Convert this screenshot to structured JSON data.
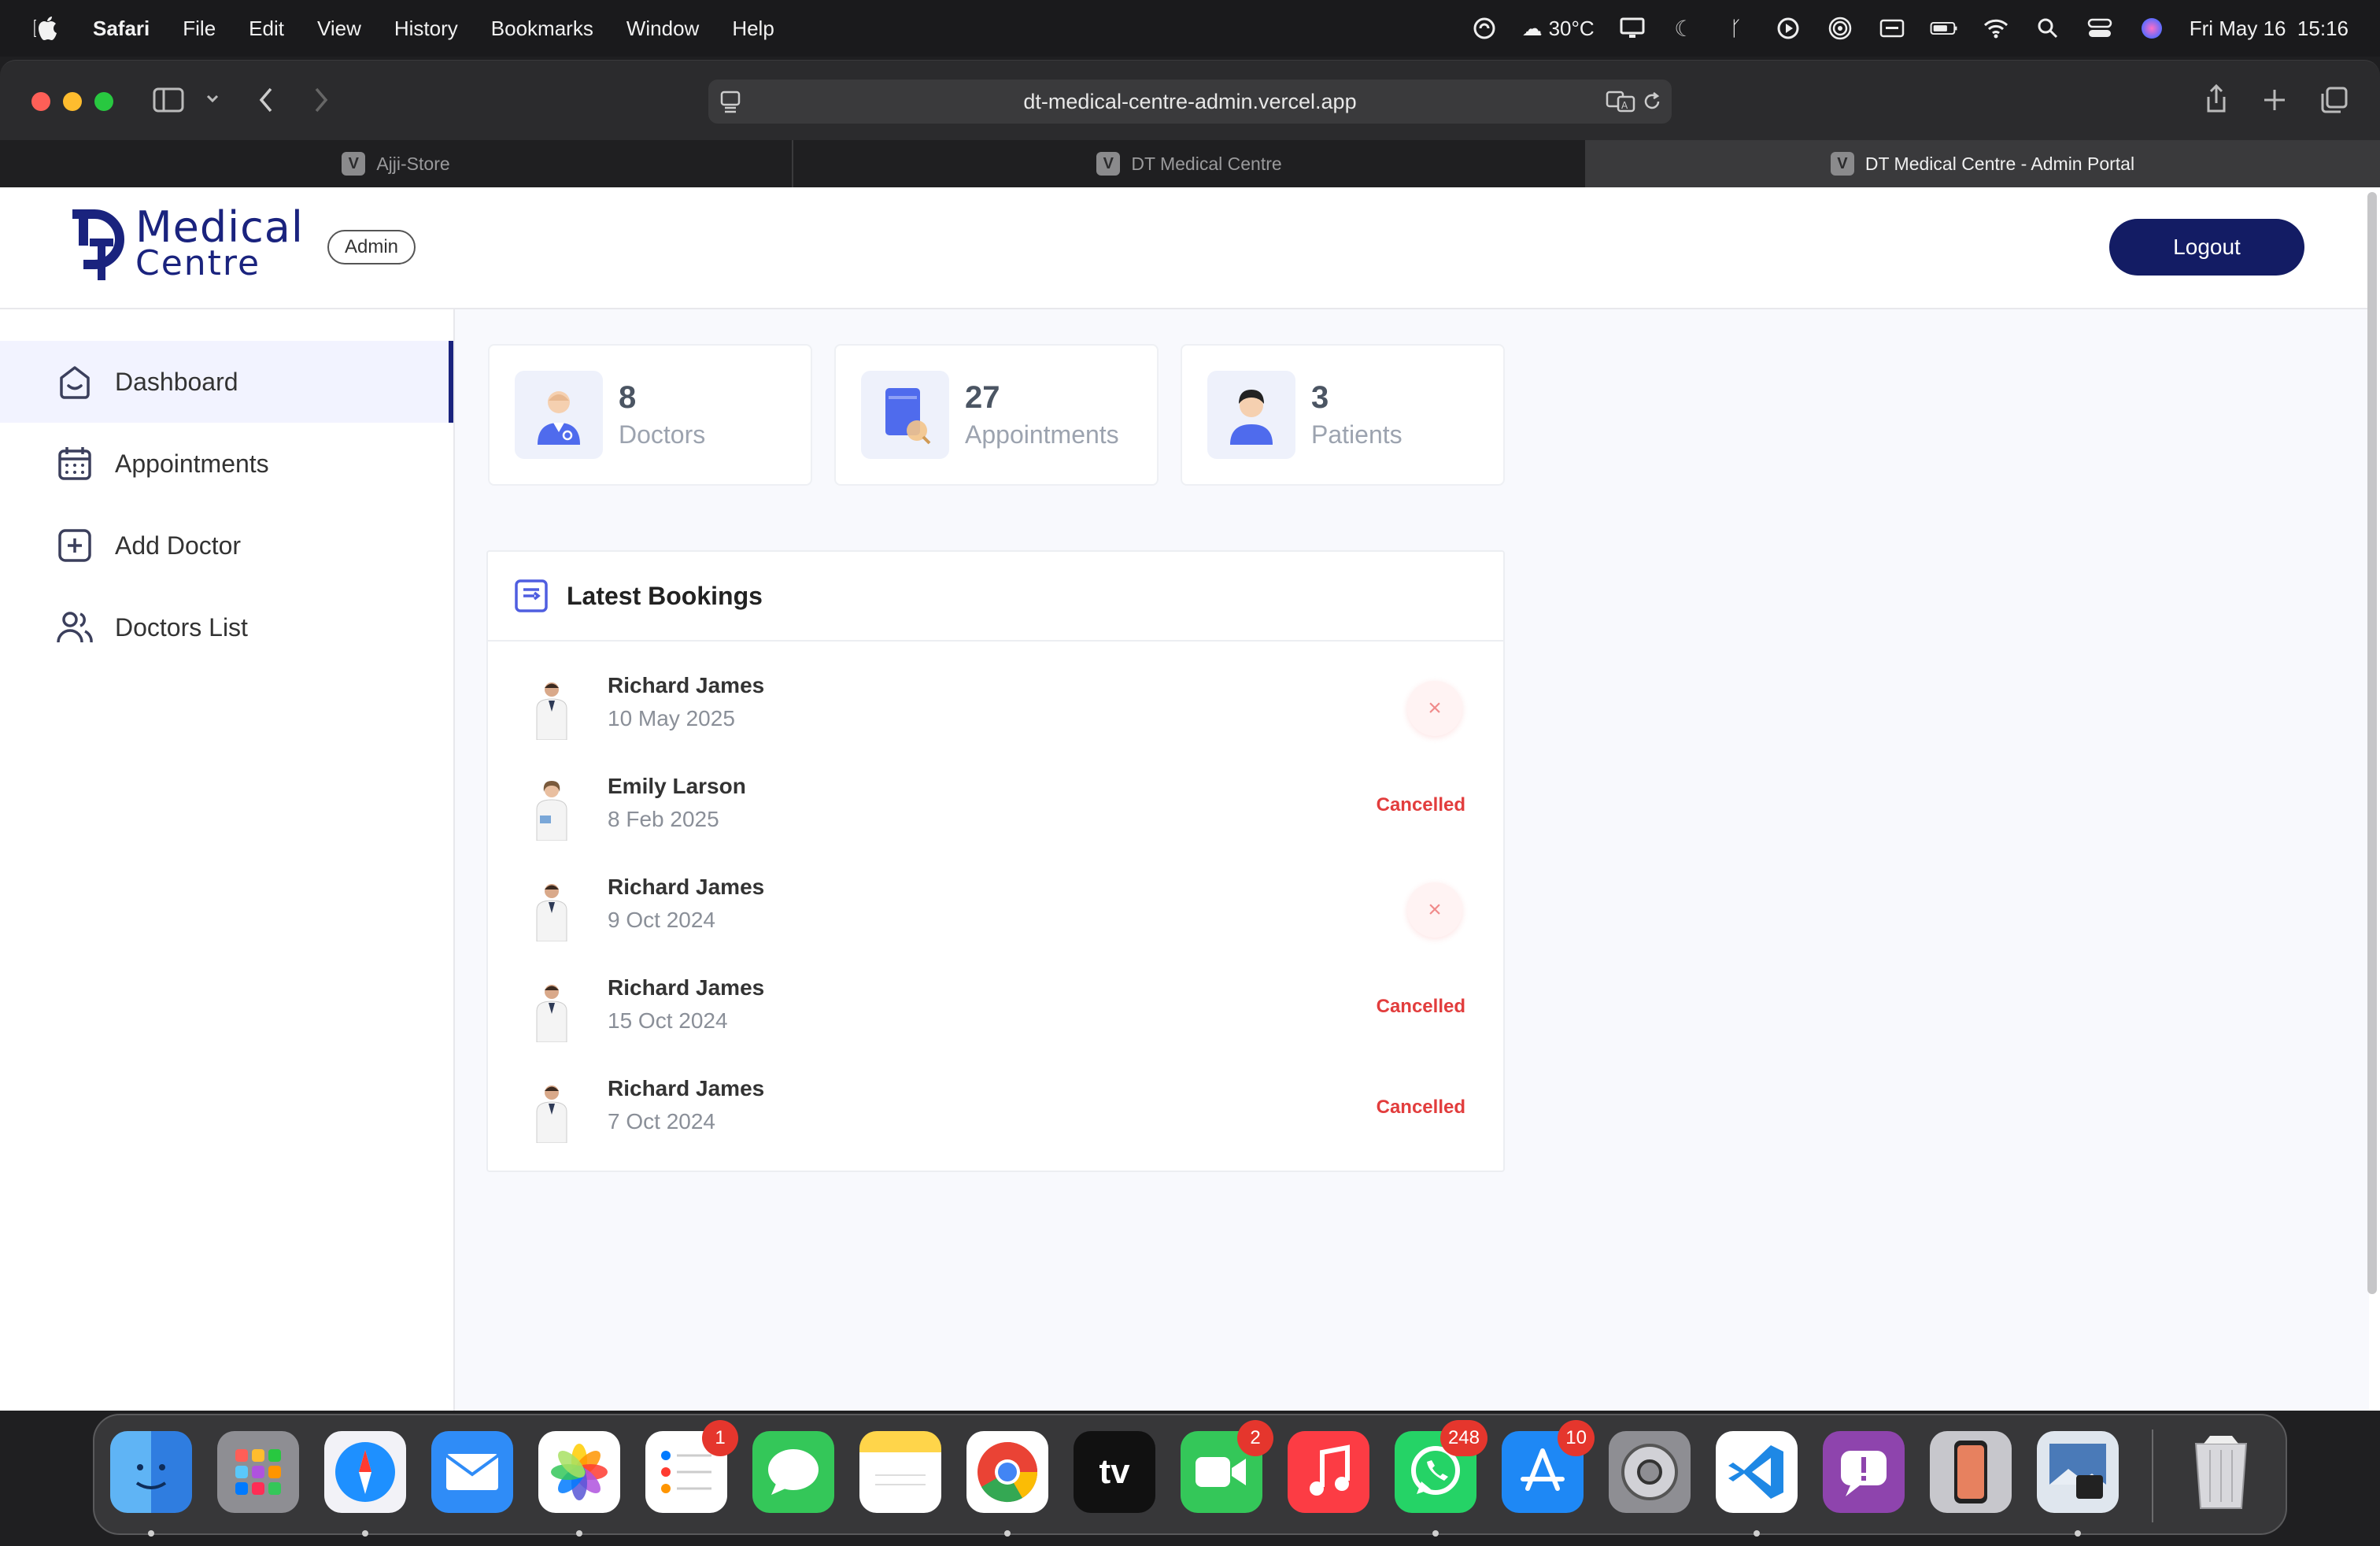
{
  "menubar": {
    "app": "Safari",
    "items": [
      "File",
      "Edit",
      "View",
      "History",
      "Bookmarks",
      "Window",
      "Help"
    ],
    "weather": "30°C",
    "datetime": "Fri May 16  15:16"
  },
  "browser": {
    "url": "dt-medical-centre-admin.vercel.app",
    "tabs": [
      {
        "label": "Ajji-Store",
        "icon_letter": "V"
      },
      {
        "label": "DT Medical Centre",
        "icon_letter": "V"
      },
      {
        "label": "DT Medical Centre - Admin Portal",
        "icon_letter": "V"
      }
    ]
  },
  "header": {
    "logo_line1": "Medical",
    "logo_line2": "Centre",
    "role_badge": "Admin",
    "logout_label": "Logout"
  },
  "sidebar": {
    "items": [
      {
        "label": "Dashboard",
        "icon": "home-icon"
      },
      {
        "label": "Appointments",
        "icon": "calendar-icon"
      },
      {
        "label": "Add Doctor",
        "icon": "add-square-icon"
      },
      {
        "label": "Doctors List",
        "icon": "people-icon"
      }
    ]
  },
  "stats": [
    {
      "value": "8",
      "label": "Doctors",
      "icon": "doctor-icon"
    },
    {
      "value": "27",
      "label": "Appointments",
      "icon": "appointments-book-icon"
    },
    {
      "value": "3",
      "label": "Patients",
      "icon": "patient-icon"
    }
  ],
  "bookings": {
    "title": "Latest Bookings",
    "rows": [
      {
        "name": "Richard James",
        "date": "10 May 2025",
        "status": "",
        "action": "×"
      },
      {
        "name": "Emily Larson",
        "date": "8 Feb 2025",
        "status": "Cancelled",
        "action": ""
      },
      {
        "name": "Richard James",
        "date": "9 Oct 2024",
        "status": "",
        "action": "×"
      },
      {
        "name": "Richard James",
        "date": "15 Oct 2024",
        "status": "Cancelled",
        "action": ""
      },
      {
        "name": "Richard James",
        "date": "7 Oct 2024",
        "status": "Cancelled",
        "action": ""
      }
    ]
  },
  "dock": {
    "badges": {
      "reminders": "1",
      "facetime": "2",
      "whatsapp": "248",
      "appstore": "10"
    },
    "tv_label": "tv"
  },
  "colors": {
    "brand": "#1a237e",
    "logout_bg": "#131c64",
    "cancelled": "#e23d3d",
    "active_nav_bg": "#f2f3ff"
  }
}
